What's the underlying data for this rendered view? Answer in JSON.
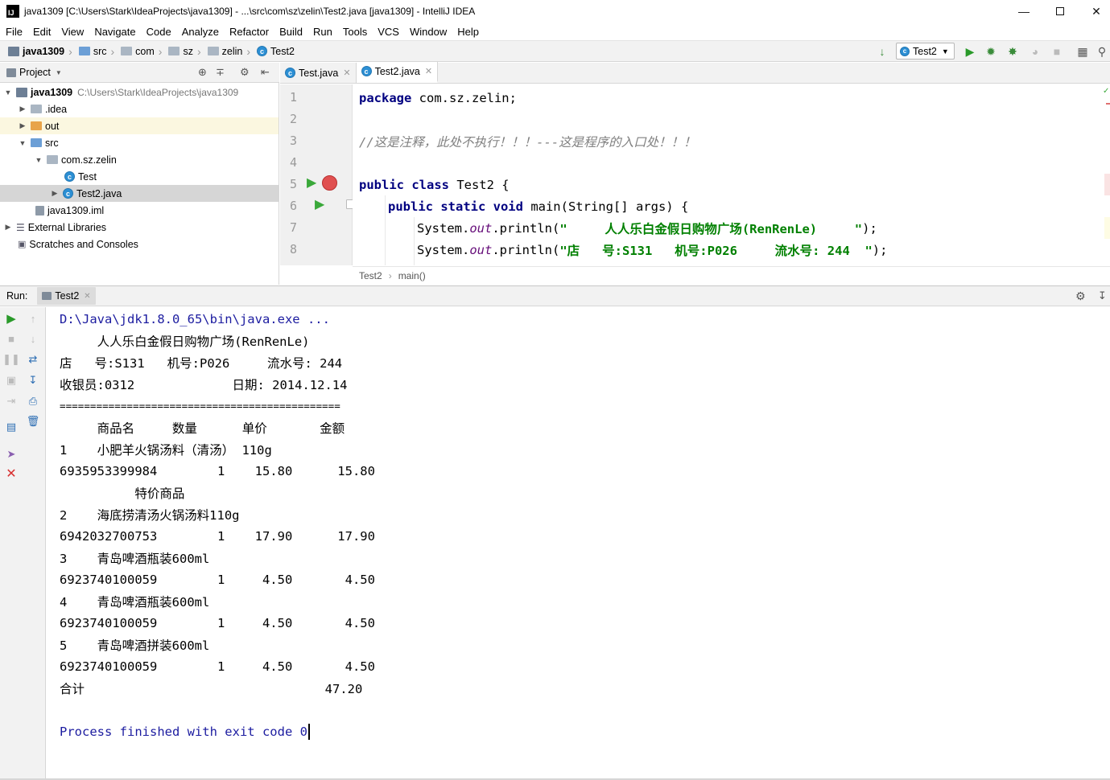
{
  "window": {
    "title": "java1309 [C:\\Users\\Stark\\IdeaProjects\\java1309] - ...\\src\\com\\sz\\zelin\\Test2.java [java1309] - IntelliJ IDEA",
    "app_icon": "IJ"
  },
  "menu": [
    "File",
    "Edit",
    "View",
    "Navigate",
    "Code",
    "Analyze",
    "Refactor",
    "Build",
    "Run",
    "Tools",
    "VCS",
    "Window",
    "Help"
  ],
  "breadcrumb": [
    "java1309",
    "src",
    "com",
    "sz",
    "zelin",
    "Test2"
  ],
  "run_config": "Test2",
  "project_pane": {
    "title": "Project",
    "tree": [
      {
        "label": "java1309",
        "path": "C:\\Users\\Stark\\IdeaProjects\\java1309"
      },
      {
        "label": ".idea"
      },
      {
        "label": "out"
      },
      {
        "label": "src"
      },
      {
        "label": "com.sz.zelin"
      },
      {
        "label": "Test"
      },
      {
        "label": "Test2.java"
      },
      {
        "label": "java1309.iml"
      },
      {
        "label": "External Libraries"
      },
      {
        "label": "Scratches and Consoles"
      }
    ]
  },
  "editor": {
    "tabs": [
      {
        "label": "Test.java",
        "active": false
      },
      {
        "label": "Test2.java",
        "active": true
      }
    ],
    "line_numbers": [
      "1",
      "2",
      "3",
      "4",
      "5",
      "6",
      "7",
      "8"
    ],
    "lines": {
      "l1_kw": "package",
      "l1_rest": " com.sz.zelin;",
      "l3_comment": "//这是注释，此处不执行！！！---这是程序的入口处！！！",
      "l5_kw": "public class",
      "l5_rest": " Test2 {",
      "l6_kw": "public static void",
      "l6_rest": " main(String[] args) {",
      "l7_a": "System.",
      "l7_field": "out",
      "l7_b": ".println(",
      "l7_str": "\"     人人乐白金假日购物广场(RenRenLe)     \"",
      "l7_end": ");",
      "l8_a": "System.",
      "l8_field": "out",
      "l8_b": ".println(",
      "l8_str": "\"店   号:S131   机号:P026     流水号: 244  \"",
      "l8_end": ");"
    },
    "crumbs": [
      "Test2",
      "main()"
    ]
  },
  "run_panel": {
    "label": "Run:",
    "tab": "Test2",
    "console": [
      "D:\\Java\\jdk1.8.0_65\\bin\\java.exe ...",
      "     人人乐白金假日购物广场(RenRenLe)",
      "店   号:S131   机号:P026     流水号: 244",
      "收银员:0312             日期: 2014.12.14",
      "==============================================",
      "     商品名     数量      单价       金额",
      "1    小肥羊火锅汤料（清汤） 110g",
      "6935953399984        1    15.80      15.80",
      "          特价商品",
      "2    海底捞清汤火锅汤料110g",
      "6942032700753        1    17.90      17.90",
      "3    青岛啤酒瓶装600ml",
      "6923740100059        1     4.50       4.50",
      "4    青岛啤酒瓶装600ml",
      "6923740100059        1     4.50       4.50",
      "5    青岛啤酒拼装600ml",
      "6923740100059        1     4.50       4.50",
      "合计                                47.20",
      "",
      "Process finished with exit code 0"
    ]
  },
  "colors": {
    "keyword": "#000080",
    "string": "#008000",
    "comment": "#808080",
    "field": "#660e7a",
    "breakpoint_line": "#fae3e3",
    "caret_line": "#fefce4"
  }
}
